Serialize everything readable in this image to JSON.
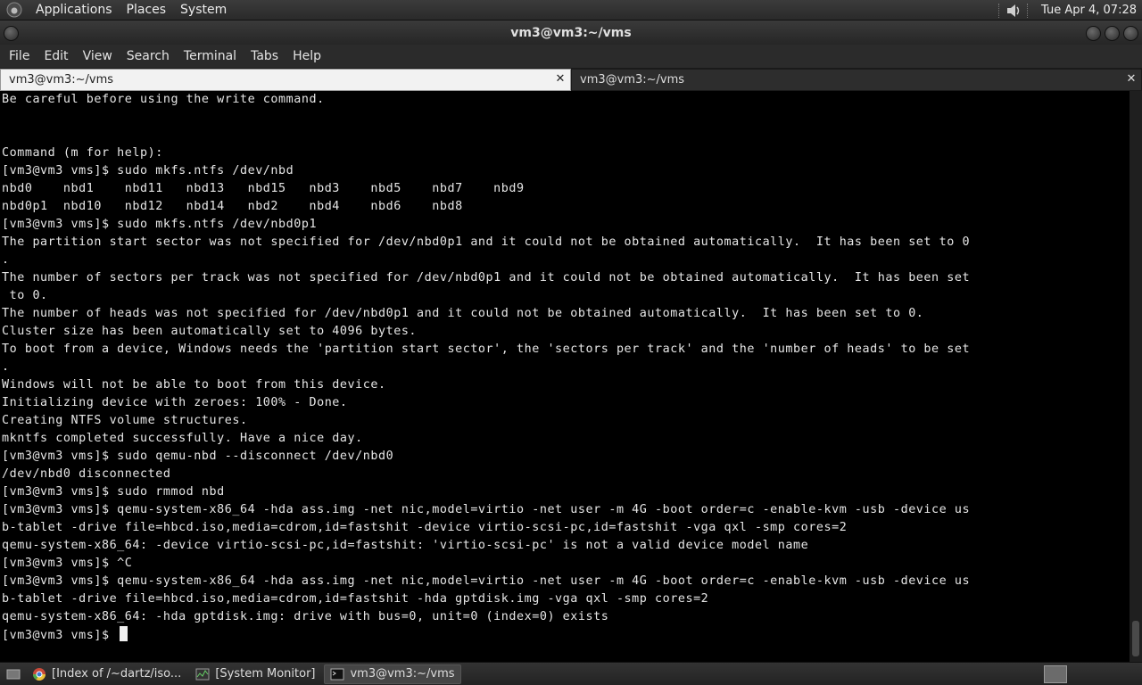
{
  "top_panel": {
    "menus": [
      "Applications",
      "Places",
      "System"
    ],
    "clock": "Tue Apr  4, 07:28"
  },
  "window": {
    "title": "vm3@vm3:~/vms"
  },
  "menubar": {
    "items": [
      "File",
      "Edit",
      "View",
      "Search",
      "Terminal",
      "Tabs",
      "Help"
    ]
  },
  "tabs": [
    {
      "label": "vm3@vm3:~/vms",
      "active": true
    },
    {
      "label": "vm3@vm3:~/vms",
      "active": false
    }
  ],
  "terminal": {
    "lines": [
      "Be careful before using the write command.",
      "",
      "",
      "Command (m for help):",
      "[vm3@vm3 vms]$ sudo mkfs.ntfs /dev/nbd",
      "nbd0    nbd1    nbd11   nbd13   nbd15   nbd3    nbd5    nbd7    nbd9",
      "nbd0p1  nbd10   nbd12   nbd14   nbd2    nbd4    nbd6    nbd8",
      "[vm3@vm3 vms]$ sudo mkfs.ntfs /dev/nbd0p1",
      "The partition start sector was not specified for /dev/nbd0p1 and it could not be obtained automatically.  It has been set to 0",
      ".",
      "The number of sectors per track was not specified for /dev/nbd0p1 and it could not be obtained automatically.  It has been set",
      " to 0.",
      "The number of heads was not specified for /dev/nbd0p1 and it could not be obtained automatically.  It has been set to 0.",
      "Cluster size has been automatically set to 4096 bytes.",
      "To boot from a device, Windows needs the 'partition start sector', the 'sectors per track' and the 'number of heads' to be set",
      ".",
      "Windows will not be able to boot from this device.",
      "Initializing device with zeroes: 100% - Done.",
      "Creating NTFS volume structures.",
      "mkntfs completed successfully. Have a nice day.",
      "[vm3@vm3 vms]$ sudo qemu-nbd --disconnect /dev/nbd0",
      "/dev/nbd0 disconnected",
      "[vm3@vm3 vms]$ sudo rmmod nbd",
      "[vm3@vm3 vms]$ qemu-system-x86_64 -hda ass.img -net nic,model=virtio -net user -m 4G -boot order=c -enable-kvm -usb -device us",
      "b-tablet -drive file=hbcd.iso,media=cdrom,id=fastshit -device virtio-scsi-pc,id=fastshit -vga qxl -smp cores=2",
      "qemu-system-x86_64: -device virtio-scsi-pc,id=fastshit: 'virtio-scsi-pc' is not a valid device model name",
      "[vm3@vm3 vms]$ ^C",
      "[vm3@vm3 vms]$ qemu-system-x86_64 -hda ass.img -net nic,model=virtio -net user -m 4G -boot order=c -enable-kvm -usb -device us",
      "b-tablet -drive file=hbcd.iso,media=cdrom,id=fastshit -hda gptdisk.img -vga qxl -smp cores=2",
      "qemu-system-x86_64: -hda gptdisk.img: drive with bus=0, unit=0 (index=0) exists",
      "[vm3@vm3 vms]$ "
    ]
  },
  "taskbar": {
    "items": [
      {
        "label": "[Index of /~dartz/iso...",
        "icon": "chrome-icon",
        "active": false
      },
      {
        "label": "[System Monitor]",
        "icon": "system-monitor-icon",
        "active": false
      },
      {
        "label": "vm3@vm3:~/vms",
        "icon": "terminal-icon",
        "active": true
      }
    ]
  },
  "colors": {
    "terminal_bg": "#000000",
    "terminal_fg": "#e6e6e6",
    "panel_bg": "#2a2a2a"
  }
}
